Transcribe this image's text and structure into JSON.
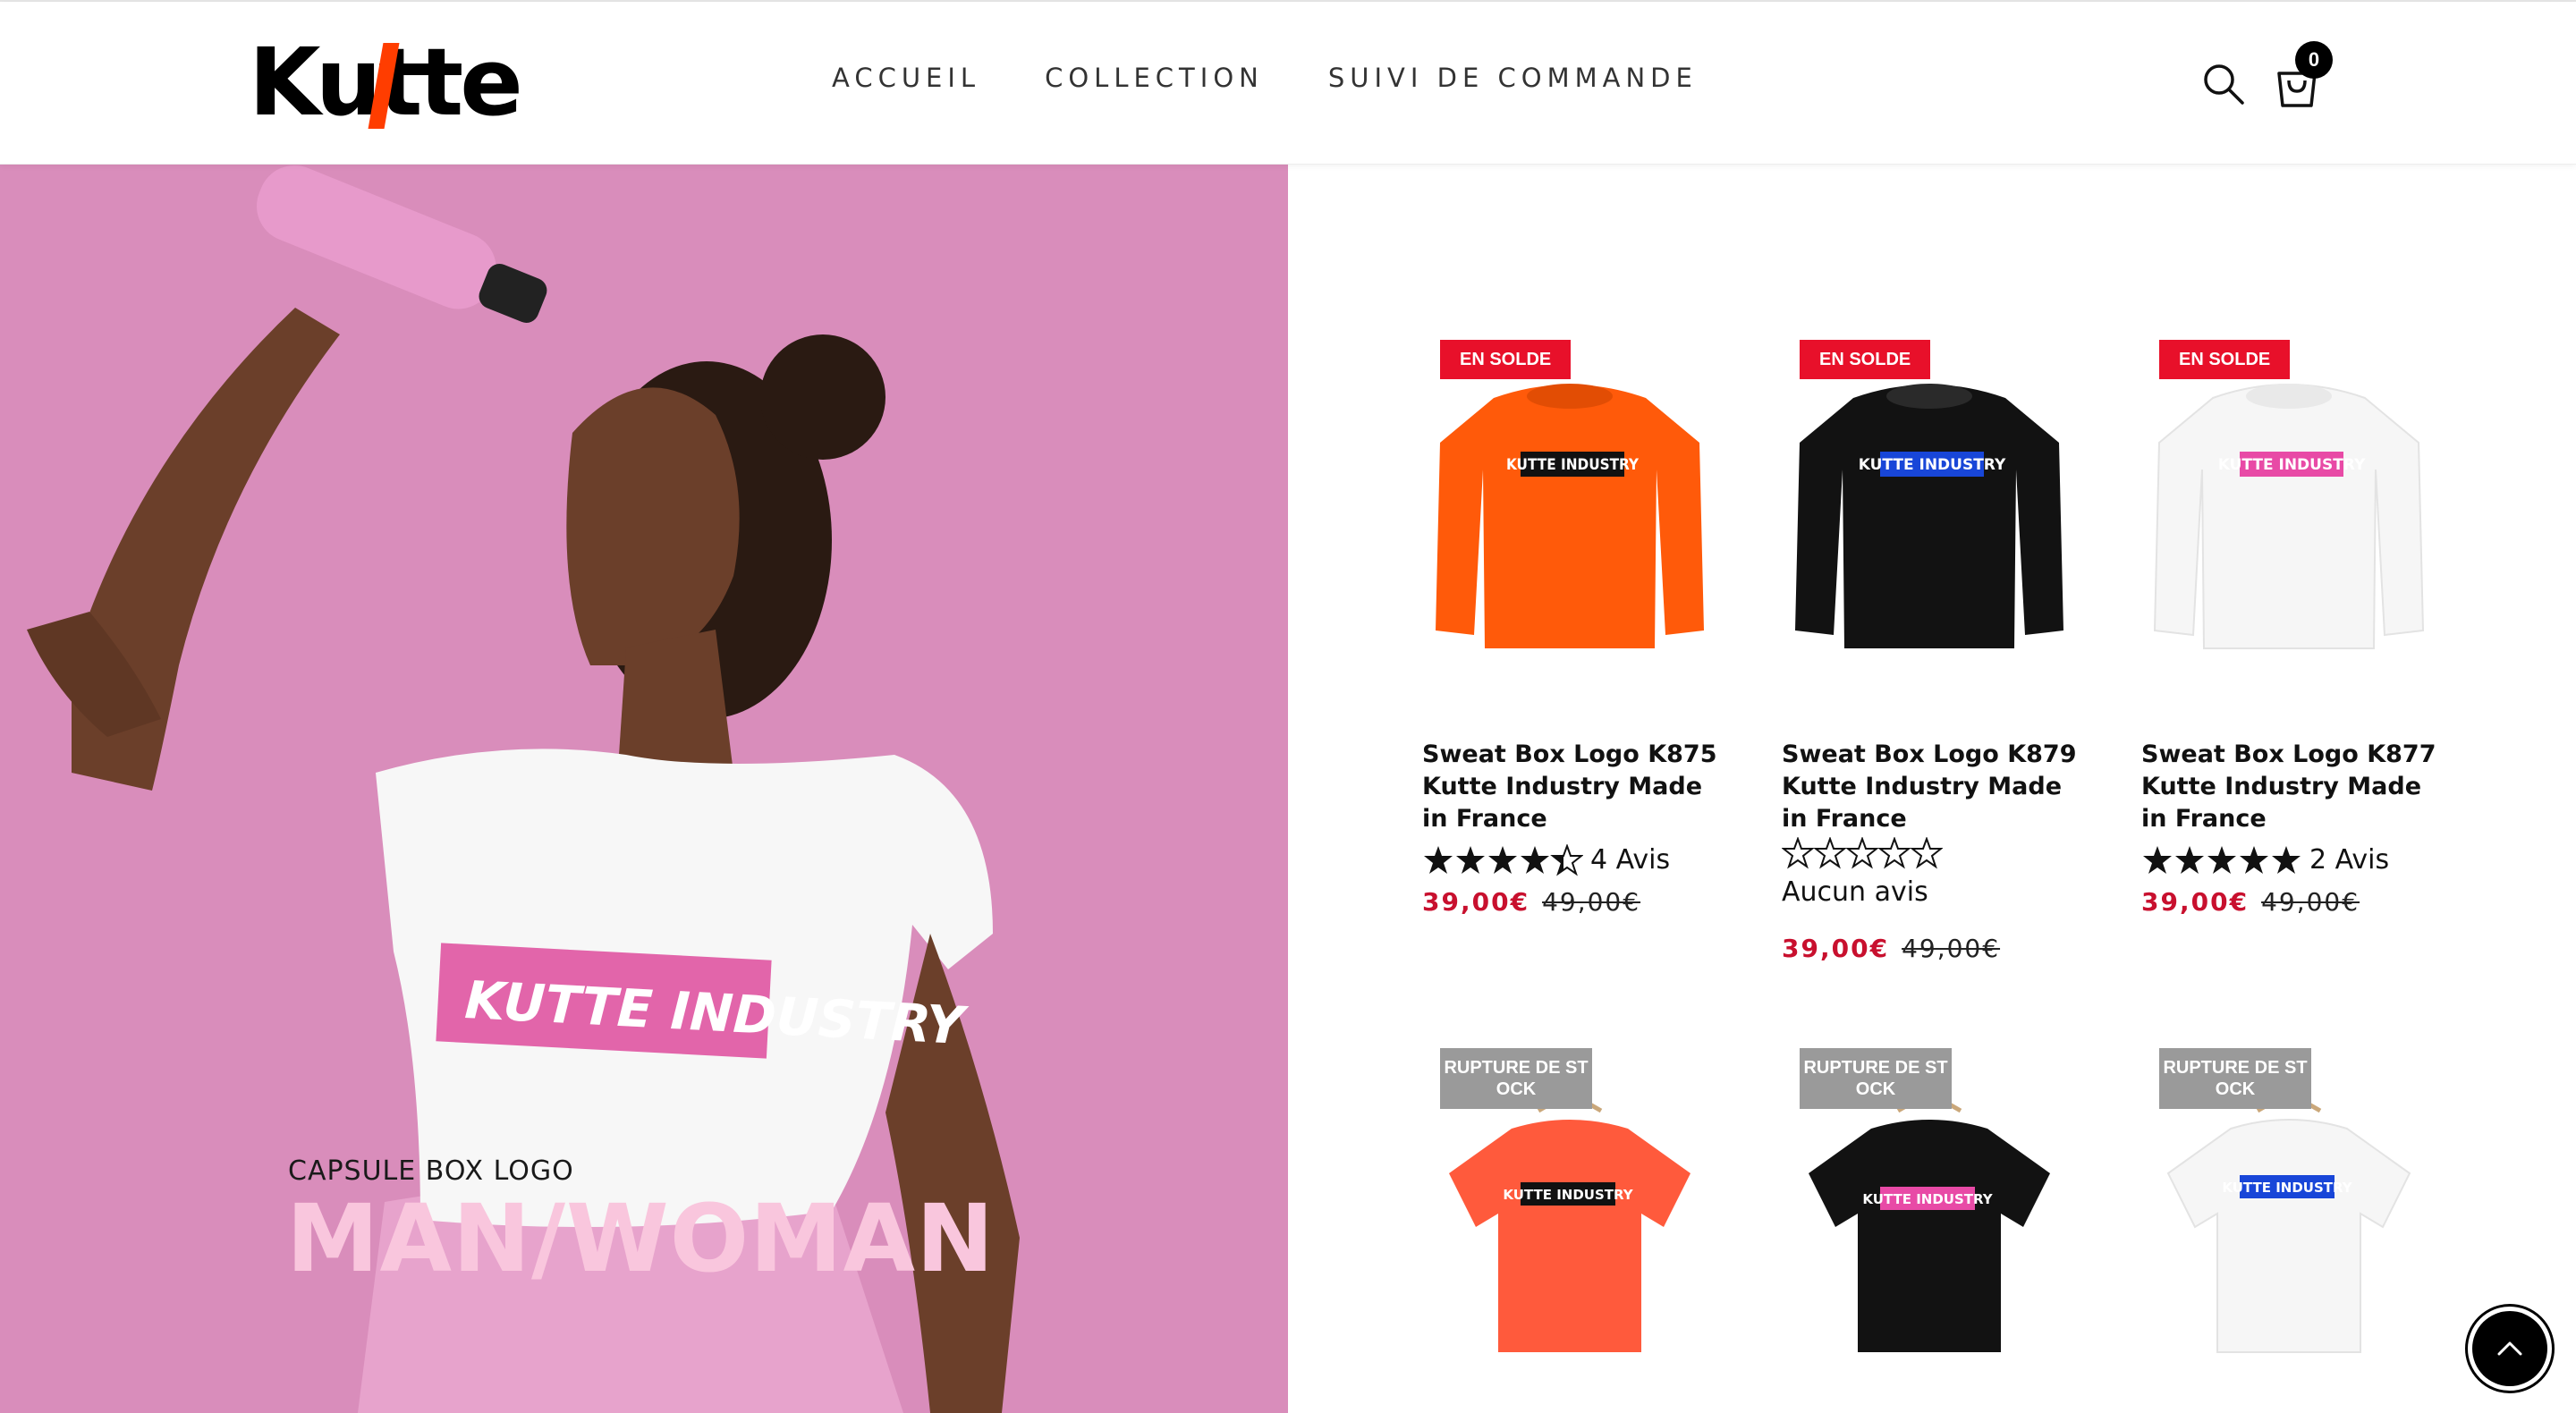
{
  "brand": {
    "logo_text": "Kutte"
  },
  "nav": {
    "items": [
      "ACCUEIL",
      "COLLECTION",
      "SUIVI DE COMMANDE"
    ]
  },
  "header": {
    "cart_count": "0",
    "icons": [
      "search-icon",
      "cart-icon"
    ]
  },
  "hero": {
    "kicker": "CAPSULE BOX LOGO",
    "title": "MAN/WOMAN",
    "bg_color": "#d98dbb",
    "title_color": "#f9c6dd"
  },
  "products": [
    {
      "badge": "EN SOLDE",
      "title": "Sweat Box Logo K875 Kutte Industry Made in France",
      "rating_value": 4.5,
      "rating_text": "4 Avis",
      "price": "39,00€",
      "old_price": "49,00€",
      "garment": "sweat",
      "color": "#ff5a0a",
      "print_bg": "#111111"
    },
    {
      "badge": "EN SOLDE",
      "title": "Sweat Box Logo K879 Kutte Industry Made in France",
      "rating_value": 0,
      "rating_text": "Aucun avis",
      "price": "39,00€",
      "old_price": "49,00€",
      "garment": "sweat",
      "color": "#121212",
      "print_bg": "#1846d8"
    },
    {
      "badge": "EN SOLDE",
      "title": "Sweat Box Logo K877 Kutte Industry Made in France",
      "rating_value": 5,
      "rating_text": "2 Avis",
      "price": "39,00€",
      "old_price": "49,00€",
      "garment": "sweat",
      "color": "#f6f6f6",
      "print_bg": "#e84aa6"
    },
    {
      "badge": "RUPTURE DE STOCK",
      "garment": "tshirt",
      "color": "#ff5a3c",
      "print_bg": "#111111"
    },
    {
      "badge": "RUPTURE DE STOCK",
      "garment": "tshirt",
      "color": "#121212",
      "print_bg": "#e84aa6"
    },
    {
      "badge": "RUPTURE DE STOCK",
      "garment": "tshirt",
      "color": "#f6f6f6",
      "print_bg": "#1846d8"
    }
  ],
  "print_text": "KUTTE INDUSTRY",
  "colors": {
    "sale_badge": "#e8102a",
    "out_badge": "#9a9a9a",
    "price": "#c8102e"
  }
}
